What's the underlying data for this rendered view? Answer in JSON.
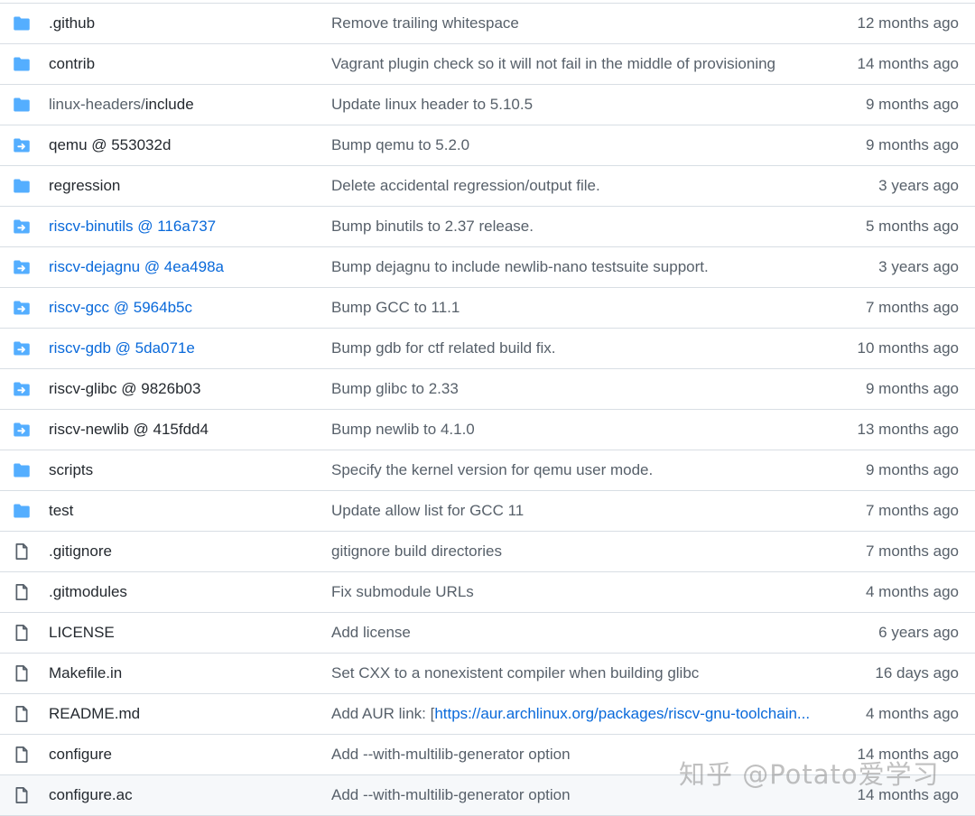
{
  "files": [
    {
      "type": "folder",
      "name": ".github",
      "message": "Remove trailing whitespace",
      "age": "12 months ago"
    },
    {
      "type": "folder",
      "name": "contrib",
      "message": "Vagrant plugin check so it will not fail in the middle of provisioning",
      "age": "14 months ago"
    },
    {
      "type": "folder",
      "name_dim": "linux-headers/",
      "name": "include",
      "message": "Update linux header to 5.10.5",
      "age": "9 months ago"
    },
    {
      "type": "submodule",
      "name": "qemu @ 553032d",
      "message": "Bump qemu to 5.2.0",
      "age": "9 months ago"
    },
    {
      "type": "folder",
      "name": "regression",
      "message": "Delete accidental regression/output file.",
      "age": "3 years ago"
    },
    {
      "type": "submodule-link",
      "name": "riscv-binutils @ 116a737",
      "message": "Bump binutils to 2.37 release.",
      "age": "5 months ago"
    },
    {
      "type": "submodule-link",
      "name": "riscv-dejagnu @ 4ea498a",
      "message": "Bump dejagnu to include newlib-nano testsuite support.",
      "age": "3 years ago"
    },
    {
      "type": "submodule-link",
      "name": "riscv-gcc @ 5964b5c",
      "message": "Bump GCC to 11.1",
      "age": "7 months ago"
    },
    {
      "type": "submodule-link",
      "name": "riscv-gdb @ 5da071e",
      "message": "Bump gdb for ctf related build fix.",
      "age": "10 months ago"
    },
    {
      "type": "submodule",
      "name": "riscv-glibc @ 9826b03",
      "message": "Bump glibc to 2.33",
      "age": "9 months ago"
    },
    {
      "type": "submodule",
      "name": "riscv-newlib @ 415fdd4",
      "message": "Bump newlib to 4.1.0",
      "age": "13 months ago"
    },
    {
      "type": "folder",
      "name": "scripts",
      "message": "Specify the kernel version for qemu user mode.",
      "age": "9 months ago"
    },
    {
      "type": "folder",
      "name": "test",
      "message": "Update allow list for GCC 11",
      "age": "7 months ago"
    },
    {
      "type": "file",
      "name": ".gitignore",
      "message": "gitignore build directories",
      "age": "7 months ago"
    },
    {
      "type": "file",
      "name": ".gitmodules",
      "message": "Fix submodule URLs",
      "age": "4 months ago"
    },
    {
      "type": "file",
      "name": "LICENSE",
      "message": "Add license",
      "age": "6 years ago"
    },
    {
      "type": "file",
      "name": "Makefile.in",
      "message": "Set CXX to a nonexistent compiler when building glibc",
      "age": "16 days ago"
    },
    {
      "type": "file",
      "name": "README.md",
      "message": "Add AUR link: [",
      "message_link": "https://aur.archlinux.org/packages/riscv-gnu-toolchain...",
      "age": "4 months ago"
    },
    {
      "type": "file",
      "name": "configure",
      "message": "Add --with-multilib-generator option",
      "age": "14 months ago"
    },
    {
      "type": "file",
      "name": "configure.ac",
      "message": "Add --with-multilib-generator option",
      "age": "14 months ago"
    }
  ],
  "watermark": "知乎 @Potato爱学习",
  "colors": {
    "folder_icon": "#54aeff",
    "file_icon": "#57606a",
    "link": "#0969da"
  },
  "icons": {
    "folder": "folder-icon",
    "submodule": "submodule-folder-icon",
    "submodule-link": "submodule-folder-icon",
    "file": "file-icon"
  }
}
